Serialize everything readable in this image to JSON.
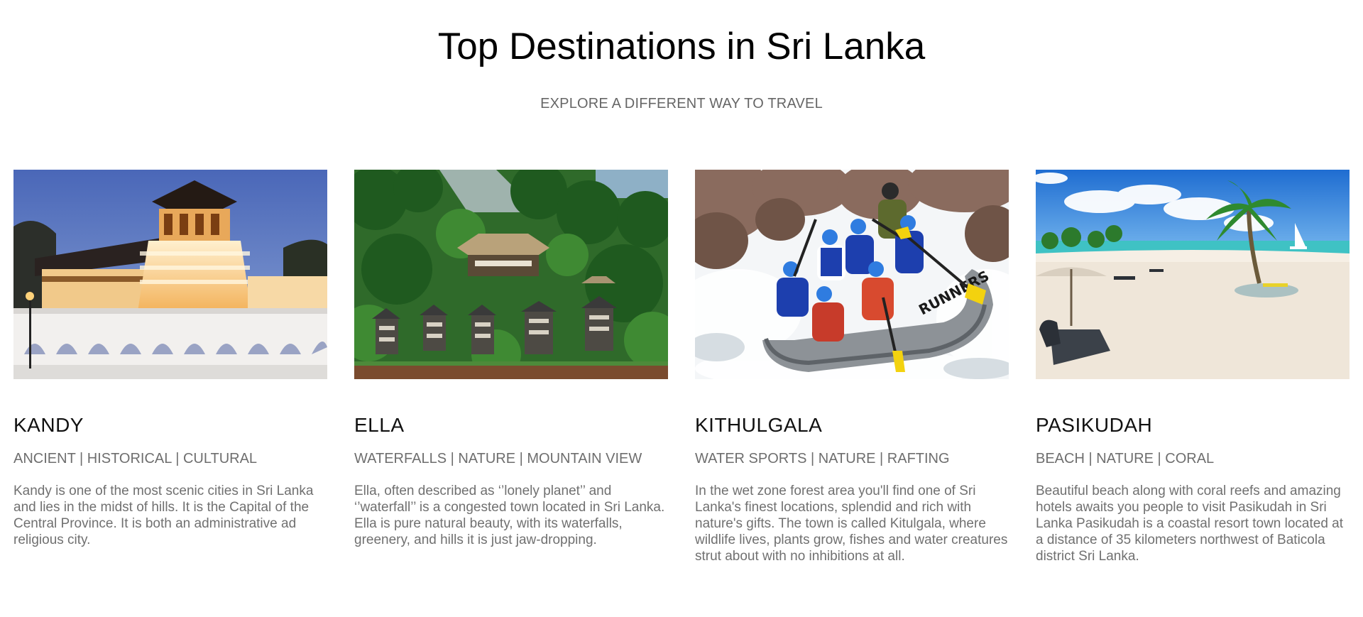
{
  "header": {
    "title": "Top Destinations in Sri Lanka",
    "subtitle": "EXPLORE A DIFFERENT WAY TO TRAVEL"
  },
  "destinations": [
    {
      "name": "KANDY",
      "tags": "ANCIENT | HISTORICAL | CULTURAL",
      "description": "Kandy is one of the most scenic cities in Sri Lanka and lies in the midst of hills. It is the Capital of the Central Province. It is both an administrative ad religious city.",
      "image": "temple-of-tooth-photo"
    },
    {
      "name": "ELLA",
      "tags": "WATERFALLS | NATURE | MOUNTAIN VIEW",
      "description": "Ella, often described as ‘’lonely planet’’ and ‘’waterfall’’ is a congested town located in Sri Lanka. Ella is pure natural beauty, with its waterfalls, greenery, and hills it is just jaw-dropping.",
      "image": "jungle-cabins-photo"
    },
    {
      "name": "KITHULGALA",
      "tags": "WATER SPORTS | NATURE | RAFTING",
      "description": "In the wet zone forest area you'll find one of Sri Lanka's finest locations, splendid and rich with nature's gifts. The town is called Kitulgala, where wildlife lives, plants grow, fishes and water creatures strut about with no inhibitions at all.",
      "image": "river-rafting-photo",
      "raft_text": "RUNNERS"
    },
    {
      "name": "PASIKUDAH",
      "tags": "BEACH | NATURE | CORAL",
      "description": "Beautiful beach along with coral reefs and amazing hotels awaits you people to visit Pasikudah in Sri Lanka Pasikudah is a coastal resort town located at a distance of 35 kilometers northwest of Baticola district Sri Lanka.",
      "image": "tropical-beach-photo"
    }
  ]
}
